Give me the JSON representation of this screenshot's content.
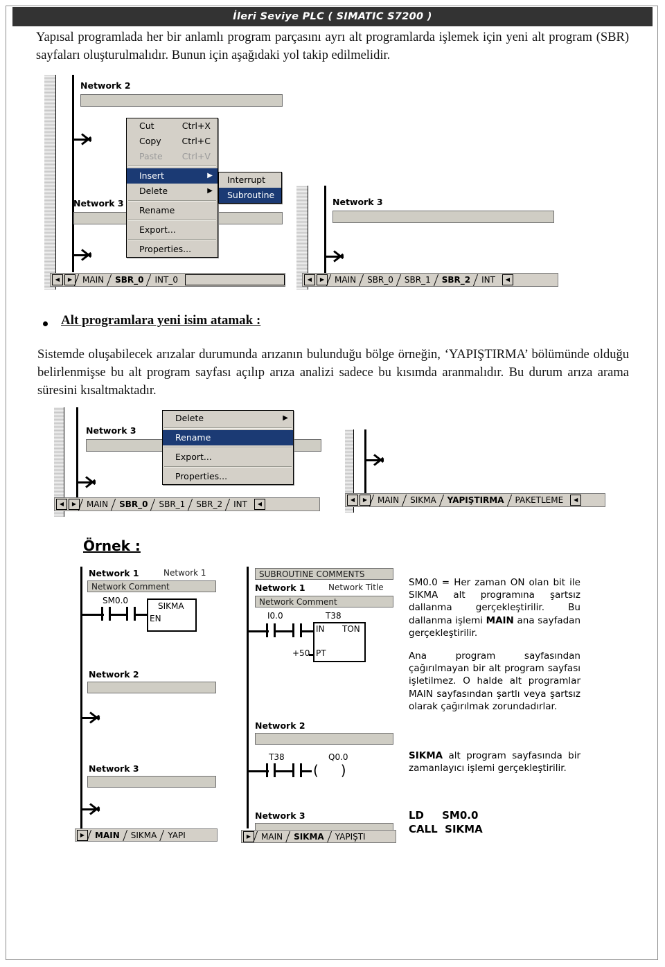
{
  "header": {
    "title": "İleri Seviye PLC ( SIMATIC S7200 )"
  },
  "intro": "Yapısal programlada her bir anlamlı program parçasını ayrı alt programlarda işlemek için yeni alt program (SBR) sayfaları oluşturulmalıdır. Bunun için aşağıdaki yol takip edilmelidir.",
  "shot1": {
    "network_2_label": "Network 2",
    "network_3_label": "Network 3",
    "menu": [
      {
        "label": "Cut",
        "accel": "Ctrl+X",
        "state": "normal"
      },
      {
        "label": "Copy",
        "accel": "Ctrl+C",
        "state": "normal"
      },
      {
        "label": "Paste",
        "accel": "Ctrl+V",
        "state": "disabled"
      },
      {
        "label": "Insert",
        "accel": "",
        "state": "selected",
        "submenu": true
      },
      {
        "label": "Delete",
        "accel": "",
        "state": "normal",
        "submenu": true
      },
      {
        "label": "Rename",
        "accel": "",
        "state": "normal"
      },
      {
        "label": "Export...",
        "accel": "",
        "state": "normal"
      },
      {
        "label": "Properties...",
        "accel": "",
        "state": "normal"
      }
    ],
    "submenu": [
      {
        "label": "Interrupt",
        "state": "normal"
      },
      {
        "label": "Subroutine",
        "state": "selected"
      }
    ],
    "tabs": [
      {
        "label": "MAIN",
        "active": false
      },
      {
        "label": "SBR_0",
        "active": true
      },
      {
        "label": "INT_0",
        "active": false
      }
    ]
  },
  "shot2": {
    "network_3_label": "Network 3",
    "tabs": [
      {
        "label": "MAIN",
        "active": false
      },
      {
        "label": "SBR_0",
        "active": false
      },
      {
        "label": "SBR_1",
        "active": false
      },
      {
        "label": "SBR_2",
        "active": true
      },
      {
        "label": "INT",
        "active": false
      }
    ]
  },
  "section": {
    "heading": "Alt programlara yeni isim atamak :",
    "paragraph": "Sistemde oluşabilecek arızalar durumunda arızanın bulunduğu bölge örneğin, ‘YAPIŞTIRMA’ bölümünde olduğu belirlenmişse bu alt program sayfası açılıp arıza analizi sadece bu kısımda aranmalıdır. Bu durum arıza arama süresini kısaltmaktadır."
  },
  "shot3": {
    "network_3_label": "Network 3",
    "menu": [
      {
        "label": "Delete",
        "state": "normal",
        "submenu": true
      },
      {
        "label": "Rename",
        "state": "selected"
      },
      {
        "label": "Export...",
        "state": "normal"
      },
      {
        "label": "Properties...",
        "state": "normal"
      }
    ],
    "tabs": [
      {
        "label": "MAIN",
        "active": false
      },
      {
        "label": "SBR_0",
        "active": true
      },
      {
        "label": "SBR_1",
        "active": false
      },
      {
        "label": "SBR_2",
        "active": false
      },
      {
        "label": "INT",
        "active": false
      }
    ]
  },
  "shot4": {
    "tabs": [
      {
        "label": "MAIN",
        "active": false
      },
      {
        "label": "SIKMA",
        "active": false
      },
      {
        "label": "YAPIŞTIRMA",
        "active": true
      },
      {
        "label": "PAKETLEME",
        "active": false
      }
    ]
  },
  "example": {
    "title": "Örnek :",
    "main_window": {
      "net1_label": "Network 1",
      "net1_title": "Network 1",
      "net1_comment": "Network Comment",
      "contact_label": "SM0.0",
      "box_title": "SIKMA",
      "box_en": "EN",
      "net2_label": "Network 2",
      "net3_label": "Network 3",
      "tabs": [
        {
          "label": "MAIN",
          "active": true
        },
        {
          "label": "SIKMA",
          "active": false
        },
        {
          "label": "YAPI",
          "active": false
        }
      ]
    },
    "sbr_window": {
      "subroutine_comments": "SUBROUTINE COMMENTS",
      "net1_label": "Network 1",
      "net1_title": "Network Title",
      "net1_comment": "Network Comment",
      "input_label": "I0.0",
      "timer_label": "T38",
      "timer_in": "IN",
      "timer_type": "TON",
      "preset_value": "+50",
      "timer_pt": "PT",
      "net2_label": "Network 2",
      "net2_contact": "T38",
      "net2_coil": "Q0.0",
      "net3_label": "Network 3",
      "tabs": [
        {
          "label": "MAIN",
          "active": false
        },
        {
          "label": "SIKMA",
          "active": true
        },
        {
          "label": "YAPIŞTI",
          "active": false
        }
      ]
    },
    "notes": {
      "p1_a": "SM0.0 = Her zaman ON olan bit ile SIKMA alt programına şartsız dallanma gerçekleştirilir. Bu dallanma işlemi ",
      "p1_b": "MAIN",
      "p1_c": " ana sayfadan gerçekleştirilir.",
      "p2": "Ana program sayfasından çağırılmayan bir alt program sayfası işletilmez. O halde alt programlar MAIN sayfasından şartlı veya şartsız olarak çağırılmak zorundadırlar.",
      "p3_a": "SIKMA",
      "p3_b": " alt program sayfasında bir zamanlayıcı işlemi gerçekleştirilir.",
      "code": "LD     SM0.0\nCALL  SIKMA"
    }
  }
}
